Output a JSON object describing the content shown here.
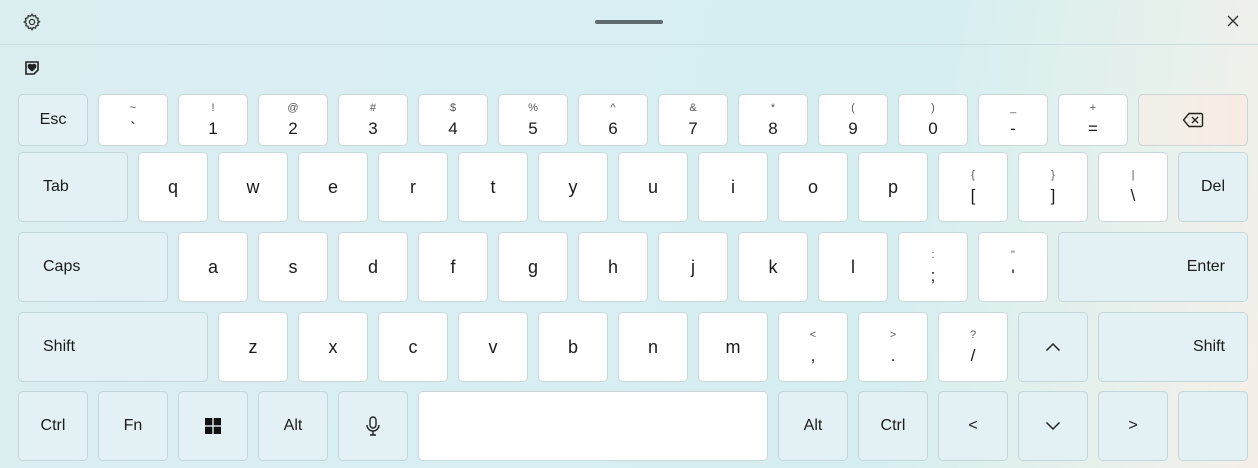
{
  "toolbar": {
    "settings_icon": "gear-icon",
    "handle_icon": "drag-handle",
    "close_label": "×",
    "emoji_icon": "heart-sticker-icon"
  },
  "rows": {
    "numbers": [
      {
        "name": "key-esc",
        "label": "Esc",
        "type": "fn"
      },
      {
        "name": "key-backtick",
        "shift": "~",
        "main": "`"
      },
      {
        "name": "key-1",
        "shift": "!",
        "main": "1"
      },
      {
        "name": "key-2",
        "shift": "@",
        "main": "2"
      },
      {
        "name": "key-3",
        "shift": "#",
        "main": "3"
      },
      {
        "name": "key-4",
        "shift": "$",
        "main": "4"
      },
      {
        "name": "key-5",
        "shift": "%",
        "main": "5"
      },
      {
        "name": "key-6",
        "shift": "^",
        "main": "6"
      },
      {
        "name": "key-7",
        "shift": "&",
        "main": "7"
      },
      {
        "name": "key-8",
        "shift": "*",
        "main": "8"
      },
      {
        "name": "key-9",
        "shift": "(",
        "main": "9"
      },
      {
        "name": "key-0",
        "shift": ")",
        "main": "0"
      },
      {
        "name": "key-minus",
        "shift": "_",
        "main": "-"
      },
      {
        "name": "key-equals",
        "shift": "+",
        "main": "="
      },
      {
        "name": "key-backspace",
        "icon": "backspace-icon",
        "type": "backspace"
      }
    ],
    "top": [
      {
        "name": "key-tab",
        "label": "Tab",
        "type": "fn"
      },
      {
        "name": "key-q",
        "label": "q"
      },
      {
        "name": "key-w",
        "label": "w"
      },
      {
        "name": "key-e",
        "label": "e"
      },
      {
        "name": "key-r",
        "label": "r"
      },
      {
        "name": "key-t",
        "label": "t"
      },
      {
        "name": "key-y",
        "label": "y"
      },
      {
        "name": "key-u",
        "label": "u"
      },
      {
        "name": "key-i",
        "label": "i"
      },
      {
        "name": "key-o",
        "label": "o"
      },
      {
        "name": "key-p",
        "label": "p"
      },
      {
        "name": "key-left-bracket",
        "shift": "{",
        "main": "["
      },
      {
        "name": "key-right-bracket",
        "shift": "}",
        "main": "]"
      },
      {
        "name": "key-backslash",
        "shift": "|",
        "main": "\\"
      },
      {
        "name": "key-del",
        "label": "Del",
        "type": "fn"
      }
    ],
    "home": [
      {
        "name": "key-caps",
        "label": "Caps",
        "type": "fn"
      },
      {
        "name": "key-a",
        "label": "a"
      },
      {
        "name": "key-s",
        "label": "s"
      },
      {
        "name": "key-d",
        "label": "d"
      },
      {
        "name": "key-f",
        "label": "f"
      },
      {
        "name": "key-g",
        "label": "g"
      },
      {
        "name": "key-h",
        "label": "h"
      },
      {
        "name": "key-j",
        "label": "j"
      },
      {
        "name": "key-k",
        "label": "k"
      },
      {
        "name": "key-l",
        "label": "l"
      },
      {
        "name": "key-semicolon",
        "shift": ":",
        "main": ";"
      },
      {
        "name": "key-quote",
        "shift": "\"",
        "main": "'"
      },
      {
        "name": "key-enter",
        "label": "Enter",
        "type": "fn"
      }
    ],
    "bottom": [
      {
        "name": "key-shift-left",
        "label": "Shift",
        "type": "fn"
      },
      {
        "name": "key-z",
        "label": "z"
      },
      {
        "name": "key-x",
        "label": "x"
      },
      {
        "name": "key-c",
        "label": "c"
      },
      {
        "name": "key-v",
        "label": "v"
      },
      {
        "name": "key-b",
        "label": "b"
      },
      {
        "name": "key-n",
        "label": "n"
      },
      {
        "name": "key-m",
        "label": "m"
      },
      {
        "name": "key-comma",
        "shift": "<",
        "main": ","
      },
      {
        "name": "key-period",
        "shift": ">",
        "main": "."
      },
      {
        "name": "key-slash",
        "shift": "?",
        "main": "/"
      },
      {
        "name": "key-up",
        "icon": "chevron-up-icon",
        "type": "fn"
      },
      {
        "name": "key-shift-right",
        "label": "Shift",
        "type": "fn"
      }
    ],
    "space": [
      {
        "name": "key-ctrl-left",
        "label": "Ctrl",
        "type": "fn"
      },
      {
        "name": "key-fn",
        "label": "Fn",
        "type": "fn"
      },
      {
        "name": "key-windows",
        "icon": "windows-logo-icon",
        "type": "fn"
      },
      {
        "name": "key-alt-left",
        "label": "Alt",
        "type": "fn"
      },
      {
        "name": "key-mic",
        "icon": "microphone-icon",
        "type": "fn"
      },
      {
        "name": "key-space",
        "label": ""
      },
      {
        "name": "key-alt-right",
        "label": "Alt",
        "type": "fn"
      },
      {
        "name": "key-ctrl-right",
        "label": "Ctrl",
        "type": "fn"
      },
      {
        "name": "key-left",
        "label": "<",
        "type": "fn"
      },
      {
        "name": "key-down",
        "icon": "chevron-down-icon",
        "type": "fn"
      },
      {
        "name": "key-right",
        "label": ">",
        "type": "fn"
      },
      {
        "name": "key-blank",
        "label": "",
        "type": "fn"
      }
    ]
  }
}
